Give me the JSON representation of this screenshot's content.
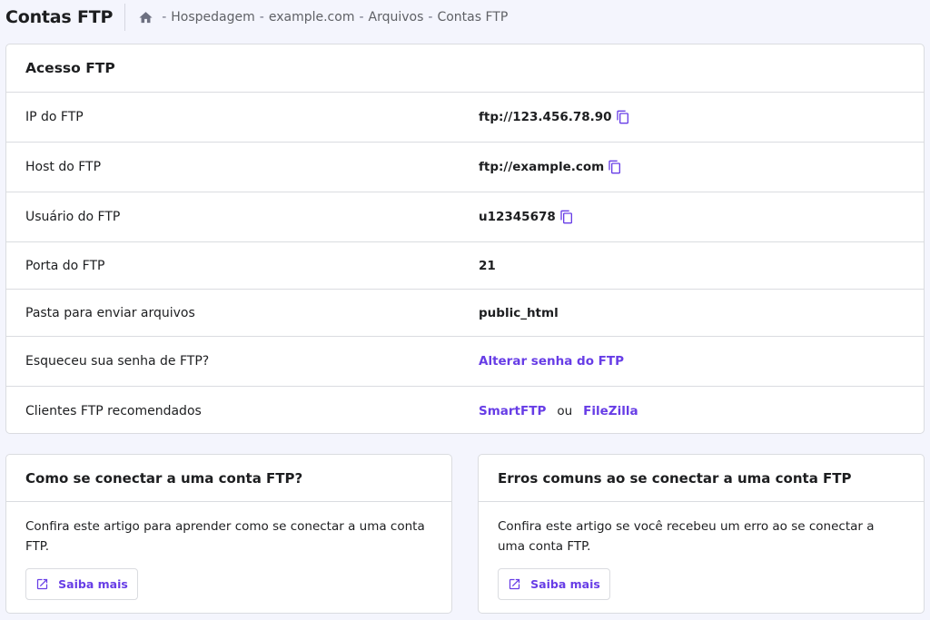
{
  "header": {
    "title": "Contas FTP",
    "breadcrumb": [
      "Hospedagem",
      "example.com",
      "Arquivos",
      "Contas FTP"
    ],
    "separator": "-"
  },
  "access": {
    "title": "Acesso FTP",
    "rows": [
      {
        "label": "IP do FTP",
        "value": "ftp://123.456.78.90"
      },
      {
        "label": "Host do FTP",
        "value": "ftp://example.com"
      },
      {
        "label": "Usuário do FTP",
        "value": "u12345678"
      },
      {
        "label": "Porta do FTP",
        "value": "21"
      },
      {
        "label": "Pasta para enviar arquivos",
        "value": "public_html"
      },
      {
        "label": "Esqueceu sua senha de FTP?",
        "value": "Alterar senha do FTP"
      },
      {
        "label": "Clientes FTP recomendados",
        "client_1": "SmartFTP",
        "or": "ou",
        "client_2": "FileZilla"
      }
    ]
  },
  "cards": [
    {
      "title": "Como se conectar a uma conta FTP?",
      "body": "Confira este artigo para aprender como se conectar a uma conta FTP.",
      "button": "Saiba mais"
    },
    {
      "title": "Erros comuns ao se conectar a uma conta FTP",
      "body": "Confira este artigo se você recebeu um erro ao se conectar a uma conta FTP.",
      "button": "Saiba mais"
    }
  ],
  "colors": {
    "accent": "#673de6",
    "background": "#f4f5fd",
    "border": "#dadce0",
    "text": "#1d1e20"
  }
}
